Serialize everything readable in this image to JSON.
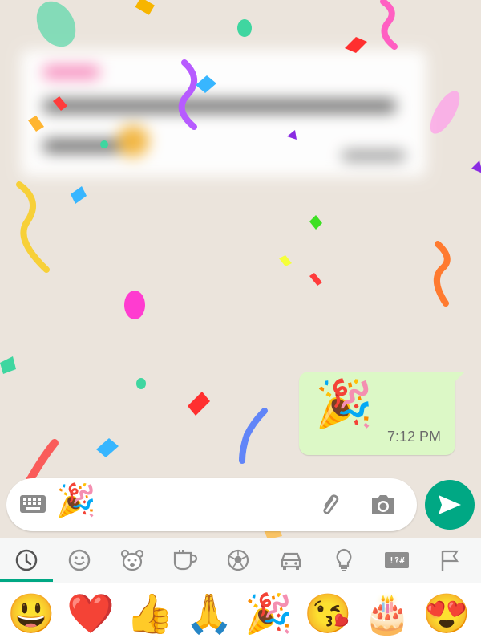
{
  "chat": {
    "outgoing_message": {
      "emoji": "🎉",
      "time": "7:12 PM"
    }
  },
  "composer": {
    "input_value": "🎉",
    "icons": [
      "keyboard-icon",
      "attach-icon",
      "camera-icon"
    ],
    "send_icon": "send-icon"
  },
  "emoji_keyboard": {
    "tabs": [
      {
        "name": "recent-icon",
        "selected": true
      },
      {
        "name": "smileys-icon"
      },
      {
        "name": "animals-icon"
      },
      {
        "name": "food-icon"
      },
      {
        "name": "activity-icon"
      },
      {
        "name": "travel-icon"
      },
      {
        "name": "objects-icon"
      },
      {
        "name": "symbols-icon",
        "label": "!?#"
      },
      {
        "name": "flags-icon"
      }
    ],
    "recent_emojis": [
      "😃",
      "❤️",
      "👍",
      "🙏",
      "🎉",
      "😘",
      "🎂",
      "😍"
    ]
  },
  "colors": {
    "accent": "#00a884",
    "outgoing_bubble": "#dcf8c6",
    "chat_background": "#ebe4dc"
  }
}
